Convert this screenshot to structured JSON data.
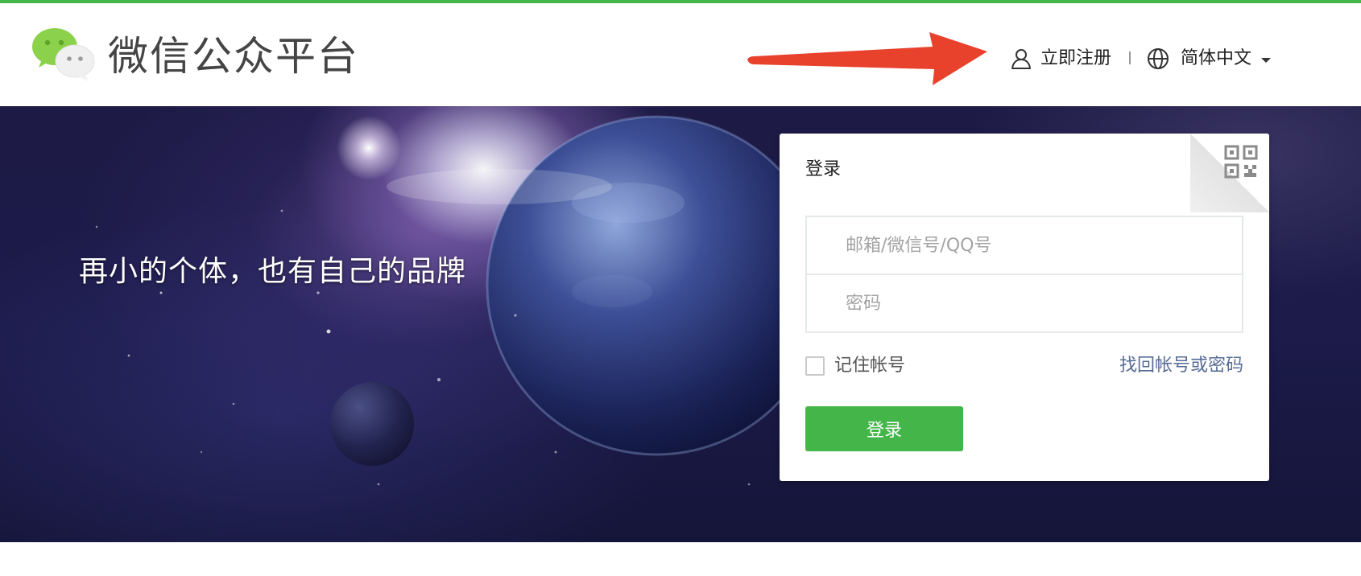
{
  "header": {
    "brand": "微信公众平台",
    "register_label": "立即注册",
    "language_label": "简体中文"
  },
  "banner": {
    "slogan": "再小的个体，也有自己的品牌"
  },
  "login": {
    "title": "登录",
    "account_placeholder": "邮箱/微信号/QQ号",
    "account_value": "",
    "password_placeholder": "密码",
    "password_value": "",
    "remember_label": "记住帐号",
    "remember_checked": false,
    "forgot_label": "找回帐号或密码",
    "submit_label": "登录"
  },
  "icons": {
    "logo": "wechat-logo-icon",
    "register": "user-icon",
    "language": "globe-icon",
    "qr": "qr-code-icon"
  },
  "colors": {
    "brand_green": "#44b549",
    "link_blue": "#576b95",
    "annotation_arrow": "#e8422c"
  }
}
